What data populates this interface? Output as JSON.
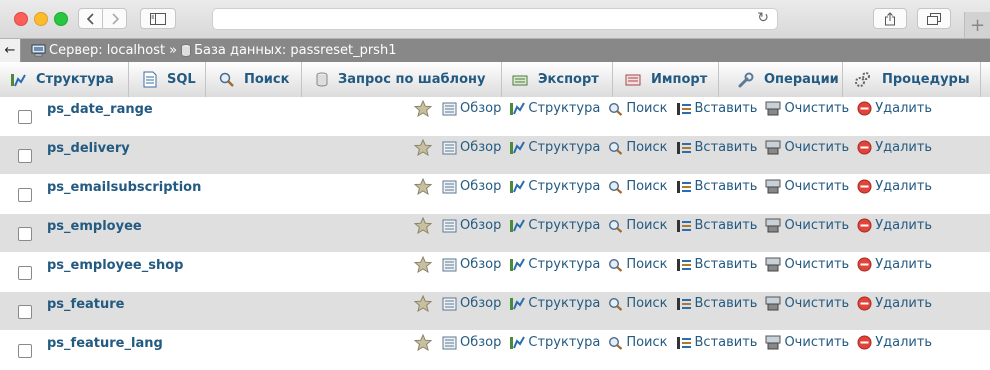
{
  "breadcrumb": {
    "back": "←",
    "server": "Сервер: localhost",
    "separator": "»",
    "database": "База данных: passreset_prsh1"
  },
  "tabs": [
    {
      "label": "Структура",
      "icon": "structure-icon"
    },
    {
      "label": "SQL",
      "icon": "sql-icon"
    },
    {
      "label": "Поиск",
      "icon": "search-icon"
    },
    {
      "label": "Запрос по шаблону",
      "icon": "query-icon"
    },
    {
      "label": "Экспорт",
      "icon": "export-icon"
    },
    {
      "label": "Импорт",
      "icon": "import-icon"
    },
    {
      "label": "Операции",
      "icon": "wrench-icon"
    },
    {
      "label": "Процедуры",
      "icon": "routines-icon"
    }
  ],
  "actions": {
    "browse": "Обзор",
    "structure": "Структура",
    "search": "Поиск",
    "insert": "Вставить",
    "empty": "Очистить",
    "drop": "Удалить"
  },
  "tables": [
    {
      "name": "ps_date_range"
    },
    {
      "name": "ps_delivery"
    },
    {
      "name": "ps_emailsubscription"
    },
    {
      "name": "ps_employee"
    },
    {
      "name": "ps_employee_shop"
    },
    {
      "name": "ps_feature"
    },
    {
      "name": "ps_feature_lang"
    }
  ]
}
